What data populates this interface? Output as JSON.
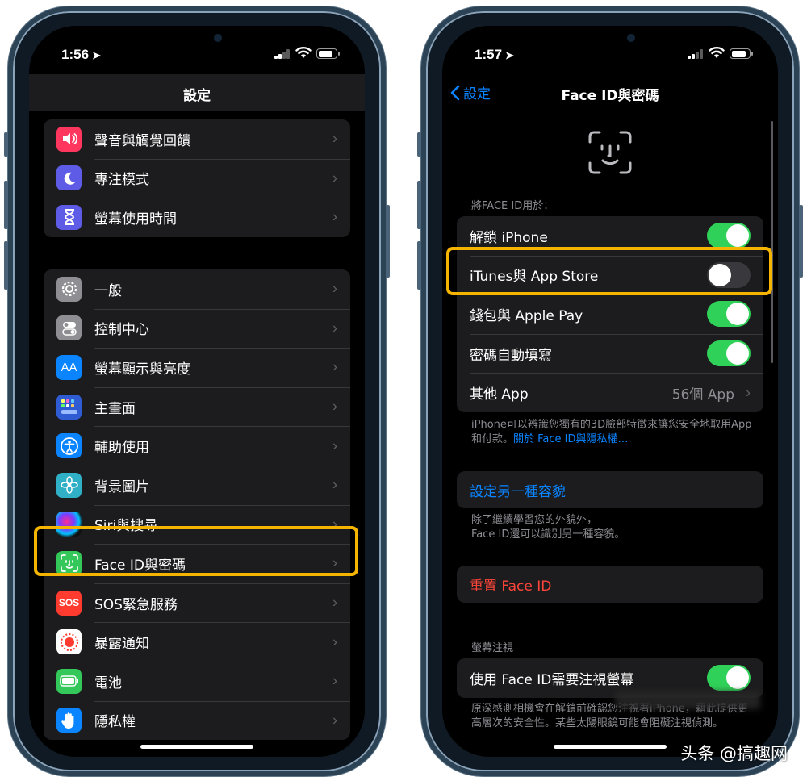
{
  "left": {
    "status": {
      "time": "1:56"
    },
    "nav": {
      "title": "設定"
    },
    "group1": [
      {
        "label": "聲音與觸覺回饋",
        "icon": "speaker-icon",
        "color": "#ff3b5c"
      },
      {
        "label": "專注模式",
        "icon": "moon-icon",
        "color": "#5e5ce6"
      },
      {
        "label": "螢幕使用時間",
        "icon": "hourglass-icon",
        "color": "#5e5ce6"
      }
    ],
    "group2": [
      {
        "label": "一般",
        "icon": "gear-icon",
        "color": "#8e8e93"
      },
      {
        "label": "控制中心",
        "icon": "toggles-icon",
        "color": "#8e8e93"
      },
      {
        "label": "螢幕顯示與亮度",
        "icon": "text-size-icon",
        "color": "#0a84ff",
        "glyph": "AA"
      },
      {
        "label": "主畫面",
        "icon": "home-grid-icon",
        "color": "#2f5bd3"
      },
      {
        "label": "輔助使用",
        "icon": "accessibility-icon",
        "color": "#0a84ff"
      },
      {
        "label": "背景圖片",
        "icon": "flower-icon",
        "color": "#30b0c7"
      },
      {
        "label": "Siri與搜尋",
        "icon": "siri-icon",
        "color": "#222"
      },
      {
        "label": "Face ID與密碼",
        "icon": "face-id-icon",
        "color": "#34c759"
      },
      {
        "label": "SOS緊急服務",
        "icon": "sos-icon",
        "color": "#ff3b30",
        "glyph": "SOS"
      },
      {
        "label": "暴露通知",
        "icon": "exposure-icon",
        "color": "#ffffff"
      },
      {
        "label": "電池",
        "icon": "battery-icon",
        "color": "#34c759"
      },
      {
        "label": "隱私權",
        "icon": "hand-icon",
        "color": "#0a84ff"
      }
    ]
  },
  "right": {
    "status": {
      "time": "1:57"
    },
    "nav": {
      "back": "設定",
      "title": "Face ID與密碼"
    },
    "section_use": "將FACE ID用於：",
    "use_rows": [
      {
        "label": "解鎖 iPhone",
        "on": true
      },
      {
        "label": "iTunes與 App Store",
        "on": false
      },
      {
        "label": "錢包與 Apple Pay",
        "on": true
      },
      {
        "label": "密碼自動填寫",
        "on": true
      }
    ],
    "other_app": {
      "label": "其他 App",
      "value": "56個 App"
    },
    "note1": "iPhone可以辨識您獨有的3D臉部特徵來讓您安全地取用App和付款。",
    "note1_link": "關於 Face ID與隱私權…",
    "alt_appearance": "設定另一種容貌",
    "note2_line1": "除了繼續學習您的外貌外，",
    "note2_line2": "Face ID還可以識別另一種容貌。",
    "reset": "重置 Face ID",
    "section_attention": "螢幕注視",
    "attention_row": {
      "label": "使用 Face ID需要注視螢幕",
      "on": true
    },
    "note3": "原深感測相機會在解鎖前確認您注視著iPhone，藉此提供更高層次的安全性。某些太陽眼鏡可能會阻礙注視偵測。"
  },
  "watermark": "头条 @搞趣网",
  "colors": {
    "accent": "#0a84ff",
    "toggle_on": "#30d158",
    "highlight": "#f5b400",
    "destructive": "#ff453a"
  }
}
